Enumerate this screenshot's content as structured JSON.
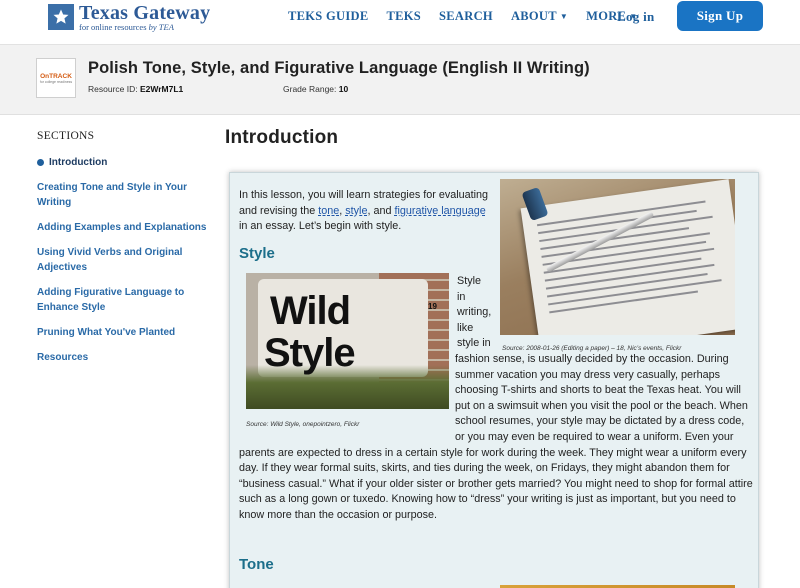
{
  "header": {
    "logo_title": "Texas Gateway",
    "logo_sub": "for online resources",
    "logo_sub_by": "by TEA",
    "nav": [
      {
        "label": "TEKS GUIDE"
      },
      {
        "label": "TEKS"
      },
      {
        "label": "SEARCH"
      },
      {
        "label": "ABOUT"
      },
      {
        "label": "MORE"
      }
    ],
    "login_label": "Log in",
    "signup_label": "Sign Up"
  },
  "resource": {
    "badge_text": "OnTRACK",
    "badge_sub": "for college readiness",
    "title": "Polish Tone, Style, and Figurative Language (English II Writing)",
    "id_label": "Resource ID:",
    "id_value": "E2WrM7L1",
    "grade_label": "Grade Range:",
    "grade_value": "10"
  },
  "sidebar": {
    "heading": "SECTIONS",
    "items": [
      {
        "label": "Introduction"
      },
      {
        "label": "Creating Tone and Style in Your Writing"
      },
      {
        "label": "Adding Examples and Explanations"
      },
      {
        "label": "Using Vivid Verbs and Original Adjectives"
      },
      {
        "label": "Adding Figurative Language to Enhance Style"
      },
      {
        "label": "Pruning What You've Planted"
      },
      {
        "label": "Resources"
      }
    ]
  },
  "main": {
    "title": "Introduction",
    "intro_a": "In this lesson, you will learn strategies for evaluating and revising the ",
    "link_tone": "tone",
    "sep1": ", ",
    "link_style": "style",
    "sep2": ", and ",
    "link_figurative": "figurative language",
    "intro_b": " in an essay. Let’s begin with style.",
    "style_heading": "Style",
    "style_words": [
      "Style",
      "in",
      "writing,",
      "like",
      "style in"
    ],
    "style_body": "fashion sense, is usually decided by the occasion. During summer vacation you may dress very casually, perhaps choosing T-shirts and shorts to beat the Texas heat. You will put on a swimsuit when you visit the pool or the beach. When school resumes, your style may be dictated by a dress code, or you may even be required to wear a uniform. Even your parents are expected to dress in a certain style for work during the week. They might wear a uniform every day. If they wear formal suits, skirts, and ties during the week, on Fridays, they might abandon them for “business casual.” What if your older sister or brother gets married? You might need to shop for formal attire such as a long gown or tuxedo. Knowing how to “dress” your writing is just as important, but you need to know more than the occasion or purpose.",
    "tone_heading": "Tone",
    "caption_paper": "Source: 2008-01-26 (Editing a paper) – 18, Nic’s events, Flickr",
    "caption_wild": "Source: Wild Style, onepointzero, Flickr",
    "wild_word1": "Wild",
    "wild_word2": "Style",
    "wild_number": "19"
  }
}
